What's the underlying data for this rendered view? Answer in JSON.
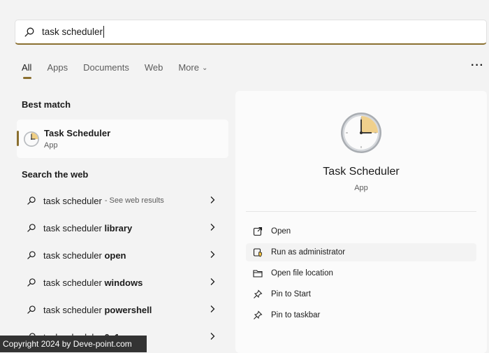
{
  "search": {
    "query": "task scheduler"
  },
  "tabs": [
    {
      "label": "All",
      "active": true
    },
    {
      "label": "Apps",
      "active": false
    },
    {
      "label": "Documents",
      "active": false
    },
    {
      "label": "Web",
      "active": false
    },
    {
      "label": "More",
      "active": false
    }
  ],
  "best_match": {
    "title": "Best match",
    "app_name": "Task Scheduler",
    "app_type": "App"
  },
  "web": {
    "title": "Search the web",
    "items": [
      {
        "prefix": "task scheduler",
        "bold": "",
        "hint": "- See web results"
      },
      {
        "prefix": "task scheduler ",
        "bold": "library",
        "hint": ""
      },
      {
        "prefix": "task scheduler ",
        "bold": "open",
        "hint": ""
      },
      {
        "prefix": "task scheduler ",
        "bold": "windows",
        "hint": ""
      },
      {
        "prefix": "task scheduler ",
        "bold": "powershell",
        "hint": ""
      },
      {
        "prefix": "task scheduler ",
        "bold": "0x1",
        "hint": ""
      }
    ]
  },
  "detail": {
    "app_name": "Task Scheduler",
    "app_type": "App",
    "actions": [
      {
        "label": "Open",
        "icon": "open-icon"
      },
      {
        "label": "Run as administrator",
        "icon": "shield-icon"
      },
      {
        "label": "Open file location",
        "icon": "folder-icon"
      },
      {
        "label": "Pin to Start",
        "icon": "pin-icon"
      },
      {
        "label": "Pin to taskbar",
        "icon": "pin-icon"
      }
    ]
  },
  "watermark": "Copyright 2024 by Deve-point.com",
  "colors": {
    "accent": "#8a6f2f",
    "background": "#f3f3f3",
    "panel": "#fbfbfb"
  }
}
